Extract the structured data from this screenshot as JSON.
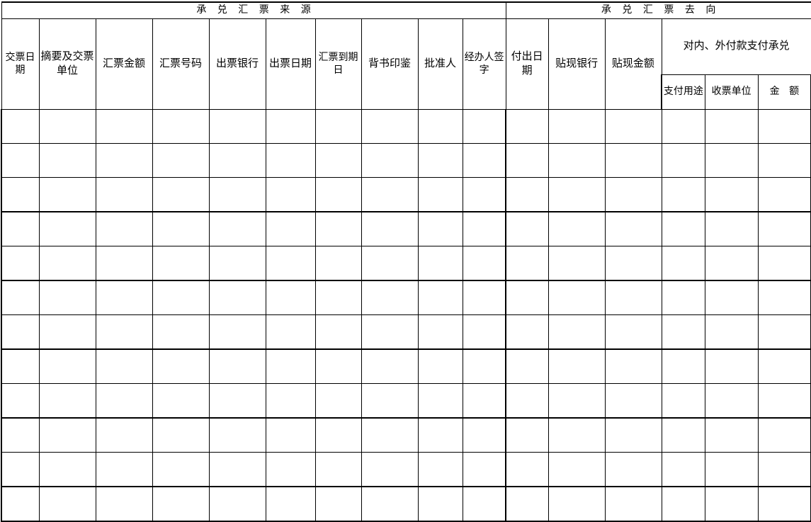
{
  "document": {
    "type": "bank-acceptance-bill-register",
    "sections": [
      {
        "id": "source",
        "title": "承 兑 汇 票 来 源"
      },
      {
        "id": "destination",
        "title": "承 兑 汇 票 去 向"
      }
    ]
  },
  "columns": {
    "source": [
      {
        "key": "delivery_date",
        "label": "交票日期"
      },
      {
        "key": "summary_unit",
        "label": "摘要及交票单位"
      },
      {
        "key": "bill_amount",
        "label": "汇票金额"
      },
      {
        "key": "bill_number",
        "label": "汇票号码"
      },
      {
        "key": "issuing_bank",
        "label": "出票银行"
      },
      {
        "key": "issue_date",
        "label": "出票日期"
      },
      {
        "key": "maturity_date",
        "label": "汇票到期日"
      },
      {
        "key": "endorsement_seal",
        "label": "背书印鉴"
      },
      {
        "key": "approver",
        "label": "批准人"
      },
      {
        "key": "handler_signature",
        "label": "经办人签字"
      }
    ],
    "destination": [
      {
        "key": "payout_date",
        "label": "付出日期"
      },
      {
        "key": "discount_bank",
        "label": "贴现银行"
      },
      {
        "key": "discount_amount",
        "label": "贴现金额"
      }
    ],
    "payment_group": {
      "label": "对内、外付款支付承兑",
      "children": [
        {
          "key": "payment_purpose",
          "label": "支付用途"
        },
        {
          "key": "payee_unit",
          "label": "收票单位"
        },
        {
          "key": "payment_amount",
          "label": "金  额"
        }
      ]
    }
  },
  "rows": [
    {
      "delivery_date": "",
      "summary_unit": "",
      "bill_amount": "",
      "bill_number": "",
      "issuing_bank": "",
      "issue_date": "",
      "maturity_date": "",
      "endorsement_seal": "",
      "approver": "",
      "handler_signature": "",
      "payout_date": "",
      "discount_bank": "",
      "discount_amount": "",
      "payment_purpose": "",
      "payee_unit": "",
      "payment_amount": ""
    },
    {
      "delivery_date": "",
      "summary_unit": "",
      "bill_amount": "",
      "bill_number": "",
      "issuing_bank": "",
      "issue_date": "",
      "maturity_date": "",
      "endorsement_seal": "",
      "approver": "",
      "handler_signature": "",
      "payout_date": "",
      "discount_bank": "",
      "discount_amount": "",
      "payment_purpose": "",
      "payee_unit": "",
      "payment_amount": ""
    },
    {
      "delivery_date": "",
      "summary_unit": "",
      "bill_amount": "",
      "bill_number": "",
      "issuing_bank": "",
      "issue_date": "",
      "maturity_date": "",
      "endorsement_seal": "",
      "approver": "",
      "handler_signature": "",
      "payout_date": "",
      "discount_bank": "",
      "discount_amount": "",
      "payment_purpose": "",
      "payee_unit": "",
      "payment_amount": ""
    },
    {
      "delivery_date": "",
      "summary_unit": "",
      "bill_amount": "",
      "bill_number": "",
      "issuing_bank": "",
      "issue_date": "",
      "maturity_date": "",
      "endorsement_seal": "",
      "approver": "",
      "handler_signature": "",
      "payout_date": "",
      "discount_bank": "",
      "discount_amount": "",
      "payment_purpose": "",
      "payee_unit": "",
      "payment_amount": ""
    },
    {
      "delivery_date": "",
      "summary_unit": "",
      "bill_amount": "",
      "bill_number": "",
      "issuing_bank": "",
      "issue_date": "",
      "maturity_date": "",
      "endorsement_seal": "",
      "approver": "",
      "handler_signature": "",
      "payout_date": "",
      "discount_bank": "",
      "discount_amount": "",
      "payment_purpose": "",
      "payee_unit": "",
      "payment_amount": ""
    },
    {
      "delivery_date": "",
      "summary_unit": "",
      "bill_amount": "",
      "bill_number": "",
      "issuing_bank": "",
      "issue_date": "",
      "maturity_date": "",
      "endorsement_seal": "",
      "approver": "",
      "handler_signature": "",
      "payout_date": "",
      "discount_bank": "",
      "discount_amount": "",
      "payment_purpose": "",
      "payee_unit": "",
      "payment_amount": ""
    },
    {
      "delivery_date": "",
      "summary_unit": "",
      "bill_amount": "",
      "bill_number": "",
      "issuing_bank": "",
      "issue_date": "",
      "maturity_date": "",
      "endorsement_seal": "",
      "approver": "",
      "handler_signature": "",
      "payout_date": "",
      "discount_bank": "",
      "discount_amount": "",
      "payment_purpose": "",
      "payee_unit": "",
      "payment_amount": ""
    },
    {
      "delivery_date": "",
      "summary_unit": "",
      "bill_amount": "",
      "bill_number": "",
      "issuing_bank": "",
      "issue_date": "",
      "maturity_date": "",
      "endorsement_seal": "",
      "approver": "",
      "handler_signature": "",
      "payout_date": "",
      "discount_bank": "",
      "discount_amount": "",
      "payment_purpose": "",
      "payee_unit": "",
      "payment_amount": ""
    },
    {
      "delivery_date": "",
      "summary_unit": "",
      "bill_amount": "",
      "bill_number": "",
      "issuing_bank": "",
      "issue_date": "",
      "maturity_date": "",
      "endorsement_seal": "",
      "approver": "",
      "handler_signature": "",
      "payout_date": "",
      "discount_bank": "",
      "discount_amount": "",
      "payment_purpose": "",
      "payee_unit": "",
      "payment_amount": ""
    },
    {
      "delivery_date": "",
      "summary_unit": "",
      "bill_amount": "",
      "bill_number": "",
      "issuing_bank": "",
      "issue_date": "",
      "maturity_date": "",
      "endorsement_seal": "",
      "approver": "",
      "handler_signature": "",
      "payout_date": "",
      "discount_bank": "",
      "discount_amount": "",
      "payment_purpose": "",
      "payee_unit": "",
      "payment_amount": ""
    },
    {
      "delivery_date": "",
      "summary_unit": "",
      "bill_amount": "",
      "bill_number": "",
      "issuing_bank": "",
      "issue_date": "",
      "maturity_date": "",
      "endorsement_seal": "",
      "approver": "",
      "handler_signature": "",
      "payout_date": "",
      "discount_bank": "",
      "discount_amount": "",
      "payment_purpose": "",
      "payee_unit": "",
      "payment_amount": ""
    },
    {
      "delivery_date": "",
      "summary_unit": "",
      "bill_amount": "",
      "bill_number": "",
      "issuing_bank": "",
      "issue_date": "",
      "maturity_date": "",
      "endorsement_seal": "",
      "approver": "",
      "handler_signature": "",
      "payout_date": "",
      "discount_bank": "",
      "discount_amount": "",
      "payment_purpose": "",
      "payee_unit": "",
      "payment_amount": ""
    }
  ],
  "style": {
    "ink": "#000000",
    "paper": "#ffffff"
  }
}
